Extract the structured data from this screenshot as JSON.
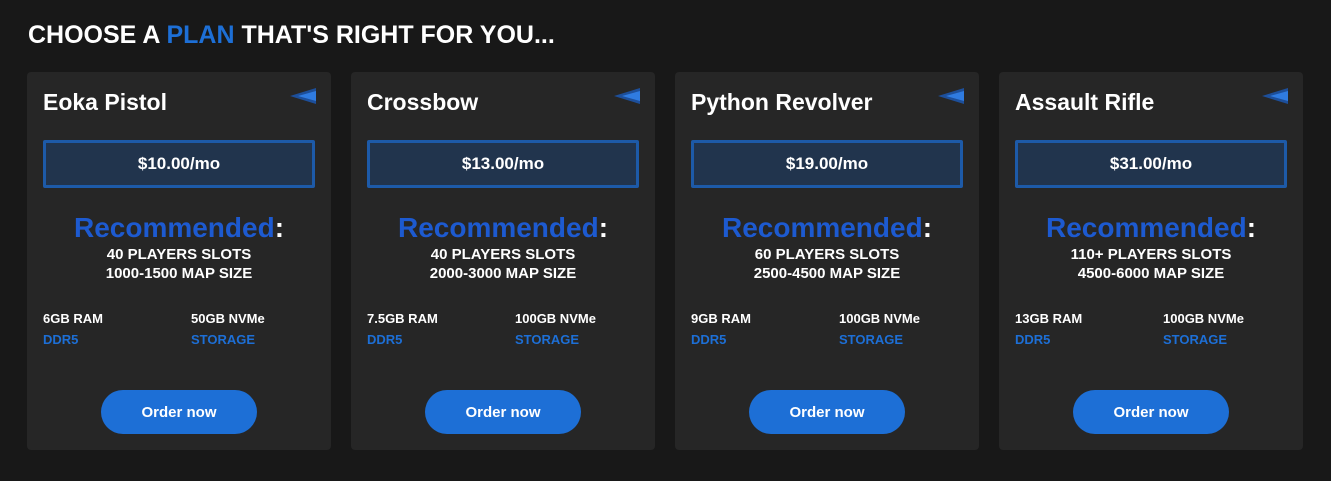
{
  "heading": {
    "prefix": "CHOOSE A ",
    "accent": "PLAN",
    "suffix": " THAT'S RIGHT FOR YOU..."
  },
  "colors": {
    "accent": "#1d6fd6",
    "background": "#181818",
    "card": "#262626",
    "price_border": "#1d5aa8",
    "price_fill": "#21344d"
  },
  "plans": [
    {
      "name": "Eoka Pistol",
      "price": "$10.00/mo",
      "recommended": "Recommended",
      "colon": ":",
      "players": "40 PLAYERS SLOTS",
      "map_size": "1000-1500 MAP SIZE",
      "ram": "6GB RAM",
      "ram_sub": "DDR5",
      "storage": "50GB NVMe",
      "storage_sub": "STORAGE",
      "button": "Order now",
      "icon": "flag-icon"
    },
    {
      "name": "Crossbow",
      "price": "$13.00/mo",
      "recommended": "Recommended",
      "colon": ":",
      "players": "40 PLAYERS SLOTS",
      "map_size": "2000-3000 MAP SIZE",
      "ram": "7.5GB RAM",
      "ram_sub": "DDR5",
      "storage": "100GB NVMe",
      "storage_sub": "STORAGE",
      "button": "Order now",
      "icon": "flag-icon"
    },
    {
      "name": "Python Revolver",
      "price": "$19.00/mo",
      "recommended": "Recommended",
      "colon": ":",
      "players": "60 PLAYERS SLOTS",
      "map_size": "2500-4500 MAP SIZE",
      "ram": "9GB RAM",
      "ram_sub": "DDR5",
      "storage": "100GB NVMe",
      "storage_sub": "STORAGE",
      "button": "Order now",
      "icon": "flag-icon"
    },
    {
      "name": "Assault Rifle",
      "price": "$31.00/mo",
      "recommended": "Recommended",
      "colon": ":",
      "players": "110+ PLAYERS SLOTS",
      "map_size": "4500-6000 MAP SIZE",
      "ram": "13GB RAM",
      "ram_sub": "DDR5",
      "storage": "100GB NVMe",
      "storage_sub": "STORAGE",
      "button": "Order now",
      "icon": "flag-icon"
    }
  ]
}
